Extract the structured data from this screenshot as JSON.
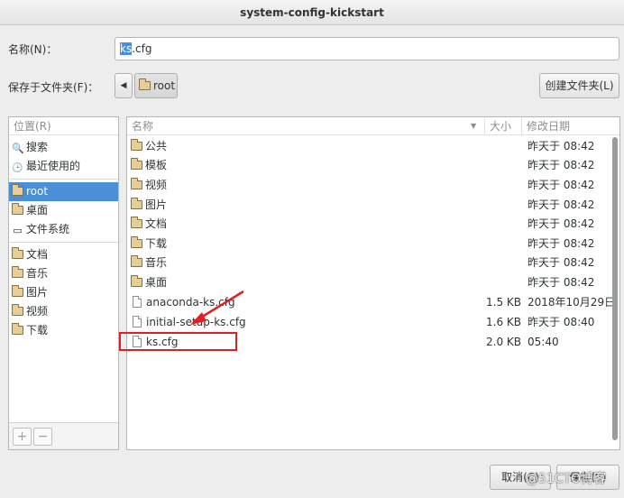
{
  "window": {
    "title": "system-config-kickstart"
  },
  "name_row": {
    "label": "名称(N)：",
    "value_selected": "ks",
    "value_rest": ".cfg"
  },
  "folder_row": {
    "label": "保存于文件夹(F)：",
    "back_icon": "◀",
    "crumb": "root",
    "create_folder": "创建文件夹(L)"
  },
  "sidebar": {
    "header": "位置(R)",
    "items": [
      {
        "icon": "search-icon",
        "glyph": "🔍",
        "label": "搜索"
      },
      {
        "icon": "clock-icon",
        "glyph": "🕒",
        "label": "最近使用的"
      },
      {
        "icon": "home-folder-icon",
        "label": "root"
      },
      {
        "icon": "folder-icon",
        "label": "桌面"
      },
      {
        "icon": "drive-icon",
        "glyph": "▭",
        "label": "文件系统"
      },
      {
        "icon": "folder-icon",
        "label": "文档"
      },
      {
        "icon": "folder-icon",
        "label": "音乐"
      },
      {
        "icon": "folder-icon",
        "label": "图片"
      },
      {
        "icon": "folder-icon",
        "label": "视频"
      },
      {
        "icon": "folder-icon",
        "label": "下载"
      }
    ],
    "add": "+",
    "remove": "−"
  },
  "file_list": {
    "columns": {
      "name": "名称",
      "size": "大小",
      "modified": "修改日期"
    },
    "sort_icon": "▼",
    "rows": [
      {
        "type": "folder",
        "name": "公共",
        "size": "",
        "modified": "昨天于 08:42"
      },
      {
        "type": "folder",
        "name": "模板",
        "size": "",
        "modified": "昨天于 08:42"
      },
      {
        "type": "folder",
        "name": "视频",
        "size": "",
        "modified": "昨天于 08:42"
      },
      {
        "type": "folder",
        "name": "图片",
        "size": "",
        "modified": "昨天于 08:42"
      },
      {
        "type": "folder",
        "name": "文档",
        "size": "",
        "modified": "昨天于 08:42"
      },
      {
        "type": "folder",
        "name": "下载",
        "size": "",
        "modified": "昨天于 08:42"
      },
      {
        "type": "folder",
        "name": "音乐",
        "size": "",
        "modified": "昨天于 08:42"
      },
      {
        "type": "folder",
        "name": "桌面",
        "size": "",
        "modified": "昨天于 08:42"
      },
      {
        "type": "file",
        "name": "anaconda-ks.cfg",
        "size": "1.5 KB",
        "modified": "2018年10月29日"
      },
      {
        "type": "file",
        "name": "initial-setup-ks.cfg",
        "size": "1.6 KB",
        "modified": "昨天于 08:40"
      },
      {
        "type": "file",
        "name": "ks.cfg",
        "size": "2.0 KB",
        "modified": "05:40"
      }
    ]
  },
  "footer": {
    "cancel": "取消(C)",
    "save": "保存(S)"
  },
  "watermark": "@51CTO博客",
  "colors": {
    "selection": "#4a90d9",
    "highlight": "#e02020"
  }
}
